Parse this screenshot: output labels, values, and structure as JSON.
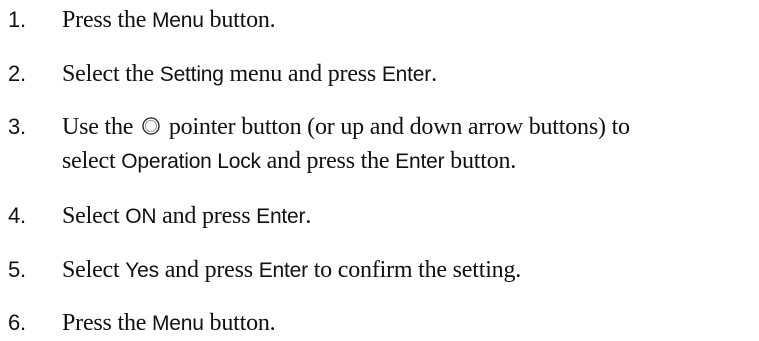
{
  "steps": [
    {
      "number": "1.",
      "pre": "Press the ",
      "ui": "Menu",
      "post": " button."
    },
    {
      "number": "2.",
      "pre": "Select the ",
      "ui": "Setting",
      "mid": " menu and press ",
      "ui2": "Enter",
      "post": "."
    },
    {
      "number": "3.",
      "pre": "Use the ",
      "icon": "pointer-circle-icon",
      "post": " pointer button (or up and down arrow buttons) to",
      "line2_pre": "select ",
      "line2_ui": "Operation Lock",
      "line2_mid": " and press the ",
      "line2_ui2": "Enter",
      "line2_post": " button."
    },
    {
      "number": "4.",
      "pre": "Select ",
      "ui": "ON",
      "mid": " and press ",
      "ui2": "Enter",
      "post": "."
    },
    {
      "number": "5.",
      "pre": "Select ",
      "ui": "Yes",
      "mid": " and press ",
      "ui2": "Enter",
      "post": " to confirm the setting."
    },
    {
      "number": "6.",
      "pre": "Press the ",
      "ui": "Menu",
      "post": " button."
    }
  ]
}
